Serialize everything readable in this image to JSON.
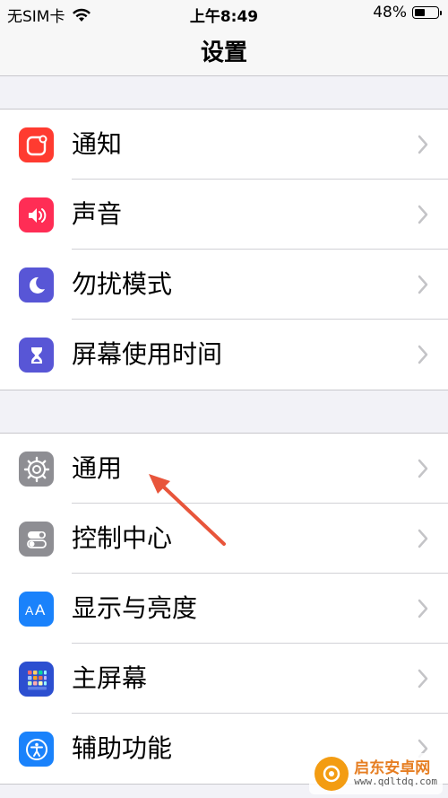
{
  "status": {
    "carrier": "无SIM卡",
    "time": "上午8:49",
    "battery": "48%",
    "battery_level": 0.48
  },
  "nav": {
    "title": "设置"
  },
  "groups": [
    {
      "items": [
        {
          "label": "通知",
          "icon": "notifications-icon",
          "color": "#ff3b30"
        },
        {
          "label": "声音",
          "icon": "sounds-icon",
          "color": "#ff2d55"
        },
        {
          "label": "勿扰模式",
          "icon": "do-not-disturb-icon",
          "color": "#5856d6"
        },
        {
          "label": "屏幕使用时间",
          "icon": "screen-time-icon",
          "color": "#5856d6"
        }
      ]
    },
    {
      "items": [
        {
          "label": "通用",
          "icon": "gear-icon",
          "color": "#8e8e93"
        },
        {
          "label": "控制中心",
          "icon": "control-center-icon",
          "color": "#8e8e93"
        },
        {
          "label": "显示与亮度",
          "icon": "display-brightness-icon",
          "color": "#1a82fb"
        },
        {
          "label": "主屏幕",
          "icon": "home-screen-icon",
          "color": "#2c4fd0"
        },
        {
          "label": "辅助功能",
          "icon": "accessibility-icon",
          "color": "#1a82fb"
        }
      ]
    }
  ],
  "watermark": {
    "title": "启东安卓网",
    "url": "www.qdltdq.com"
  }
}
